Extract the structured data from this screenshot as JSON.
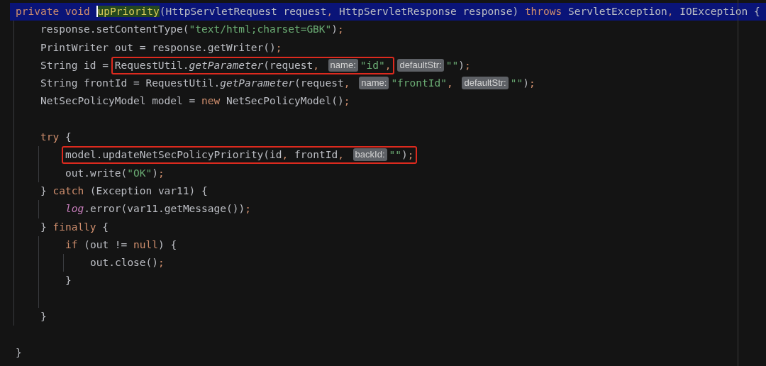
{
  "editor": {
    "lines": [
      {
        "kind": "code",
        "highlighted": true,
        "tokens": [
          {
            "kind": "keyword",
            "text": "private void "
          },
          {
            "kind": "match",
            "text": "upPriority"
          },
          {
            "kind": "plain",
            "text": "(HttpServletRequest request"
          },
          {
            "kind": "punct",
            "text": ", "
          },
          {
            "kind": "plain",
            "text": "HttpServletResponse response) "
          },
          {
            "kind": "keyword",
            "text": "throws "
          },
          {
            "kind": "plain",
            "text": "ServletException"
          },
          {
            "kind": "punct",
            "text": ", "
          },
          {
            "kind": "plain",
            "text": "IOException {"
          }
        ],
        "children": [
          {
            "kind": "code",
            "tokens": [
              {
                "kind": "plain",
                "text": "response.setContentType("
              },
              {
                "kind": "string",
                "text": "\"text/html;charset=GBK\""
              },
              {
                "kind": "plain",
                "text": ")"
              },
              {
                "kind": "punct",
                "text": ";"
              }
            ]
          },
          {
            "kind": "code",
            "tokens": [
              {
                "kind": "plain",
                "text": "PrintWriter out = response.getWriter()"
              },
              {
                "kind": "punct",
                "text": ";"
              }
            ]
          },
          {
            "kind": "code",
            "tokens": [
              {
                "kind": "plain",
                "text": "String id = "
              },
              {
                "kind": "frame",
                "tokens": [
                  {
                    "kind": "plain",
                    "text": "RequestUtil."
                  },
                  {
                    "kind": "italic",
                    "text": "getParameter"
                  },
                  {
                    "kind": "plain",
                    "text": "(request"
                  },
                  {
                    "kind": "punct",
                    "text": ", "
                  },
                  {
                    "kind": "hint",
                    "text": "name:"
                  },
                  {
                    "kind": "string",
                    "text": "\"id\""
                  },
                  {
                    "kind": "punct",
                    "text": ","
                  }
                ]
              },
              {
                "kind": "hint",
                "text": "defaultStr:"
              },
              {
                "kind": "string",
                "text": "\"\""
              },
              {
                "kind": "plain",
                "text": ")"
              },
              {
                "kind": "punct",
                "text": ";"
              }
            ]
          },
          {
            "kind": "code",
            "tokens": [
              {
                "kind": "plain",
                "text": "String frontId = RequestUtil."
              },
              {
                "kind": "italic",
                "text": "getParameter"
              },
              {
                "kind": "plain",
                "text": "(request"
              },
              {
                "kind": "punct",
                "text": ", "
              },
              {
                "kind": "hint",
                "text": "name:"
              },
              {
                "kind": "string",
                "text": "\"frontId\""
              },
              {
                "kind": "punct",
                "text": ", "
              },
              {
                "kind": "hint",
                "text": "defaultStr:"
              },
              {
                "kind": "string",
                "text": "\"\""
              },
              {
                "kind": "plain",
                "text": ")"
              },
              {
                "kind": "punct",
                "text": ";"
              }
            ]
          },
          {
            "kind": "code",
            "tokens": [
              {
                "kind": "plain",
                "text": "NetSecPolicyModel model = "
              },
              {
                "kind": "keyword",
                "text": "new "
              },
              {
                "kind": "plain",
                "text": "NetSecPolicyModel()"
              },
              {
                "kind": "punct",
                "text": ";"
              }
            ]
          },
          {
            "kind": "blank"
          },
          {
            "kind": "code",
            "tokens": [
              {
                "kind": "keyword",
                "text": "try "
              },
              {
                "kind": "plain",
                "text": "{"
              }
            ],
            "children": [
              {
                "kind": "code",
                "tokens": [
                  {
                    "kind": "frame",
                    "tokens": [
                      {
                        "kind": "plain",
                        "text": "model.updateNetSecPolicyPriority(id"
                      },
                      {
                        "kind": "punct",
                        "text": ", "
                      },
                      {
                        "kind": "plain",
                        "text": "frontId"
                      },
                      {
                        "kind": "punct",
                        "text": ", "
                      },
                      {
                        "kind": "hint",
                        "text": "backId:"
                      },
                      {
                        "kind": "string",
                        "text": "\"\""
                      },
                      {
                        "kind": "plain",
                        "text": ")"
                      },
                      {
                        "kind": "punct",
                        "text": ";"
                      }
                    ]
                  }
                ]
              },
              {
                "kind": "code",
                "tokens": [
                  {
                    "kind": "plain",
                    "text": "out.write("
                  },
                  {
                    "kind": "string",
                    "text": "\"OK\""
                  },
                  {
                    "kind": "plain",
                    "text": ")"
                  },
                  {
                    "kind": "punct",
                    "text": ";"
                  }
                ]
              }
            ]
          },
          {
            "kind": "code",
            "tokens": [
              {
                "kind": "plain",
                "text": "} "
              },
              {
                "kind": "keyword",
                "text": "catch "
              },
              {
                "kind": "plain",
                "text": "(Exception var11) {"
              }
            ],
            "children": [
              {
                "kind": "code",
                "tokens": [
                  {
                    "kind": "field",
                    "text": "log"
                  },
                  {
                    "kind": "plain",
                    "text": ".error(var11.getMessage())"
                  },
                  {
                    "kind": "punct",
                    "text": ";"
                  }
                ]
              }
            ]
          },
          {
            "kind": "code",
            "tokens": [
              {
                "kind": "plain",
                "text": "} "
              },
              {
                "kind": "keyword",
                "text": "finally "
              },
              {
                "kind": "plain",
                "text": "{"
              }
            ],
            "children": [
              {
                "kind": "code",
                "tokens": [
                  {
                    "kind": "keyword",
                    "text": "if "
                  },
                  {
                    "kind": "plain",
                    "text": "(out != "
                  },
                  {
                    "kind": "keyword",
                    "text": "null"
                  },
                  {
                    "kind": "plain",
                    "text": ") {"
                  }
                ],
                "children": [
                  {
                    "kind": "code",
                    "tokens": [
                      {
                        "kind": "plain",
                        "text": "out.close()"
                      },
                      {
                        "kind": "punct",
                        "text": ";"
                      }
                    ]
                  }
                ]
              },
              {
                "kind": "code",
                "tokens": [
                  {
                    "kind": "plain",
                    "text": "}"
                  }
                ]
              },
              {
                "kind": "blank"
              }
            ]
          },
          {
            "kind": "code",
            "tokens": [
              {
                "kind": "plain",
                "text": "}"
              }
            ]
          }
        ]
      },
      {
        "kind": "blank",
        "highlighted": false
      },
      {
        "kind": "code",
        "highlighted": false,
        "tokens": [
          {
            "kind": "plain",
            "text": "}"
          }
        ]
      }
    ]
  }
}
